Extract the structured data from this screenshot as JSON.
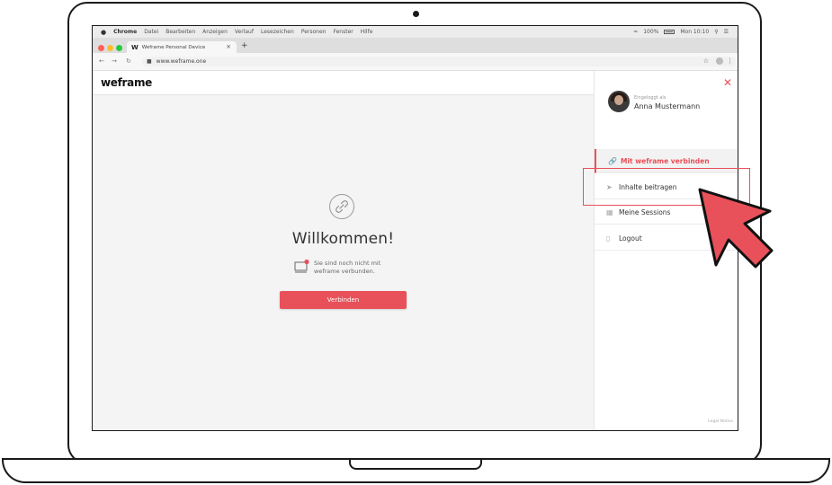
{
  "menubar": {
    "app": "Chrome",
    "items": [
      "Datei",
      "Bearbeiten",
      "Anzeigen",
      "Verlauf",
      "Lesezeichen",
      "Personen",
      "Fenster",
      "Hilfe"
    ],
    "battery": "100%",
    "clock": "Mon 10:10"
  },
  "browser": {
    "tab_title": "Weframe Personal Device",
    "tab_favicon": "W",
    "url": "www.weframe.one"
  },
  "app": {
    "logo": "weframe"
  },
  "main": {
    "welcome": "Willkommen!",
    "status_line1": "Sie sind noch nicht mit",
    "status_line2": "weframe verbunden.",
    "connect_label": "Verbinden"
  },
  "sidebar": {
    "logged_in_as": "Eingeloggt als",
    "user_name": "Anna Mustermann",
    "items": [
      {
        "label": "Mit weframe verbinden",
        "icon": "link-icon"
      },
      {
        "label": "Inhalte beitragen",
        "icon": "send-icon"
      },
      {
        "label": "Meine Sessions",
        "icon": "grid-icon"
      },
      {
        "label": "Logout",
        "icon": "logout-icon"
      }
    ],
    "legal": "Legal Notice"
  },
  "colors": {
    "accent": "#e8515a",
    "background": "#f4f4f4"
  }
}
